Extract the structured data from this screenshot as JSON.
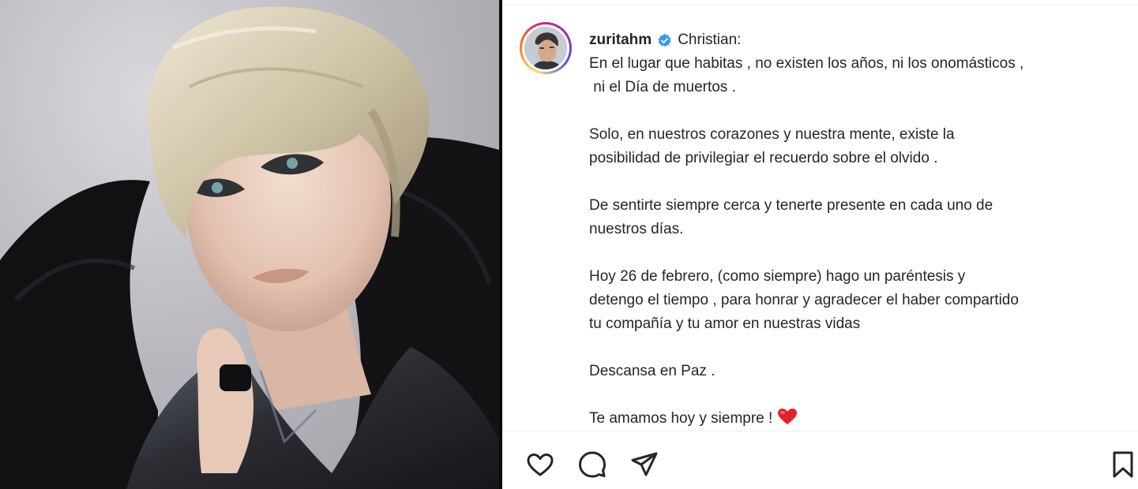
{
  "post": {
    "username": "zuritahm",
    "verified": true,
    "caption_lines": [
      {
        "text": " Christian:",
        "style": "head"
      },
      {
        "text": "En el lugar que habitas , no existen los años, ni los onomásticos ,\n ni el Día de muertos ."
      },
      {
        "text": "Solo, en nuestros corazones y nuestra mente, existe la\nposibilidad de privilegiar el recuerdo sobre el olvido ."
      },
      {
        "text": "De sentirte siempre cerca y tenerte presente en cada uno de\nnuestros días."
      },
      {
        "text": "Hoy 26 de febrero, (como siempre) hago un paréntesis y\ndetengo el tiempo , para honrar y agradecer el haber compartido\ntu compañía y tu amor en nuestras vidas"
      },
      {
        "text": "Descansa en Paz ."
      },
      {
        "text": "Te amamos hoy y siempre !",
        "emoji": "red-heart"
      }
    ],
    "header_greeting": "Christian:",
    "line1": "En el lugar que habitas , no existen los años, ni los onomásticos ,",
    "line2": " ni el Día de muertos .",
    "p2_l1": "Solo, en nuestros corazones y nuestra mente, existe la",
    "p2_l2": "posibilidad de privilegiar el recuerdo sobre el olvido .",
    "p3_l1": "De sentirte siempre cerca y tenerte presente en cada uno de",
    "p3_l2": "nuestros días.",
    "p4_l1": "Hoy 26 de febrero, (como siempre) hago un paréntesis y",
    "p4_l2": "detengo el tiempo , para honrar y agradecer el haber compartido",
    "p4_l3": "tu compañía y tu amor en nuestras vidas",
    "p5": "Descansa en Paz .",
    "p6": "Te amamos hoy y siempre !"
  },
  "icons": {
    "verified": "verified-badge-icon",
    "like": "heart-icon",
    "comment": "comment-icon",
    "share": "paper-plane-icon",
    "save": "bookmark-icon",
    "emoji": "red-heart-emoji"
  },
  "colors": {
    "text": "#262626",
    "verified": "#3897f0",
    "heart_emoji": "#e0242b",
    "icon_stroke": "#262626"
  }
}
